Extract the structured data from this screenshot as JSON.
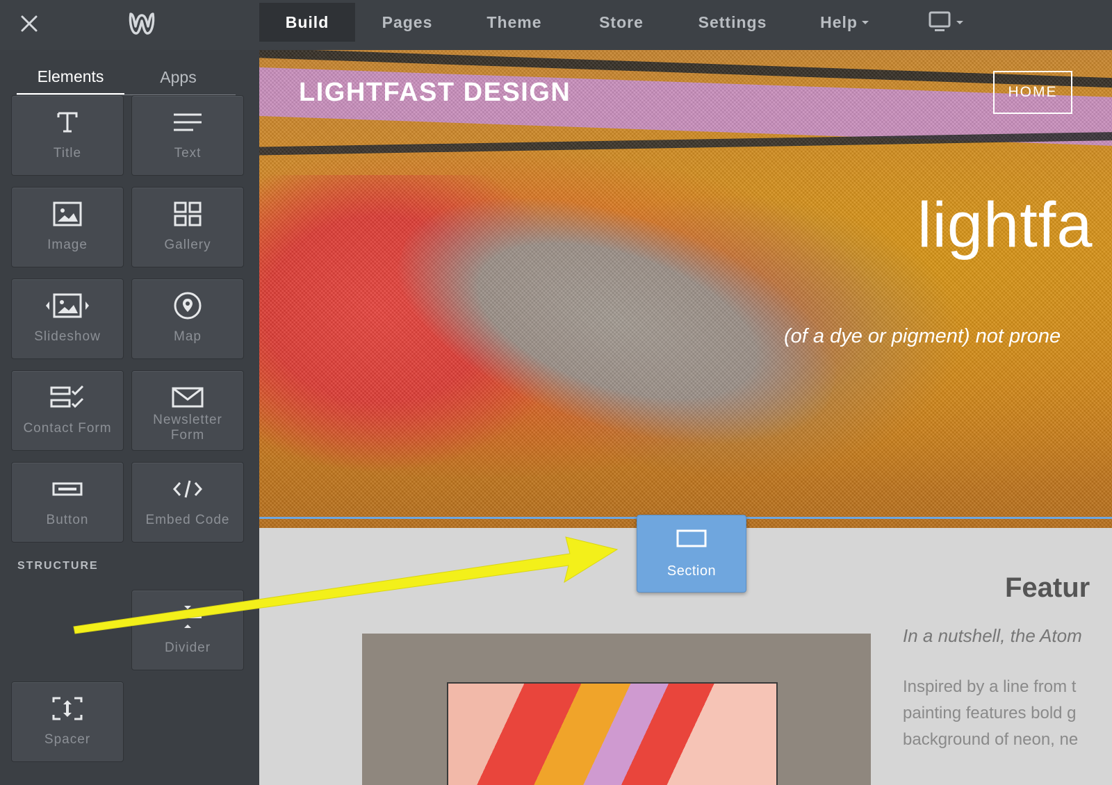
{
  "topbar": {
    "nav": [
      {
        "label": "Build",
        "active": true
      },
      {
        "label": "Pages"
      },
      {
        "label": "Theme"
      },
      {
        "label": "Store"
      },
      {
        "label": "Settings"
      },
      {
        "label": "Help",
        "has_dropdown": true
      }
    ],
    "icons": {
      "close": "close-icon",
      "logo": "weebly-logo-icon",
      "device": "desktop-device-icon"
    }
  },
  "sidebar": {
    "tabs": [
      {
        "label": "Elements",
        "active": true
      },
      {
        "label": "Apps"
      }
    ],
    "elements": [
      {
        "label": "Title",
        "icon": "title-icon"
      },
      {
        "label": "Text",
        "icon": "text-icon"
      },
      {
        "label": "Image",
        "icon": "image-icon"
      },
      {
        "label": "Gallery",
        "icon": "gallery-icon"
      },
      {
        "label": "Slideshow",
        "icon": "slideshow-icon"
      },
      {
        "label": "Map",
        "icon": "map-pin-icon"
      },
      {
        "label": "Contact Form",
        "icon": "contact-form-icon"
      },
      {
        "label": "Newsletter Form",
        "icon": "envelope-icon"
      },
      {
        "label": "Button",
        "icon": "button-icon"
      },
      {
        "label": "Embed Code",
        "icon": "code-icon"
      }
    ],
    "structure_heading": "STRUCTURE",
    "structure": [
      {
        "label": "Divider",
        "icon": "divider-icon"
      },
      {
        "label": "Spacer",
        "icon": "spacer-icon"
      }
    ]
  },
  "canvas": {
    "site_title": "LIGHTFAST DESIGN",
    "nav_home": "HOME",
    "hero_heading": "lightfa",
    "hero_subtitle": "(of a dye or pigment) not prone",
    "feature_title": "Featur",
    "feature_intro": "In a nutshell, the Atom",
    "feature_body": [
      "Inspired by a line from t",
      "painting features bold g",
      "background of neon, ne"
    ]
  },
  "drag": {
    "label": "Section",
    "icon": "section-icon"
  },
  "colors": {
    "accent_blue": "#6fa6de",
    "annotation_arrow": "#f3f01a",
    "sidebar_bg": "#3b3f44",
    "topbar_bg": "#3d4146"
  }
}
